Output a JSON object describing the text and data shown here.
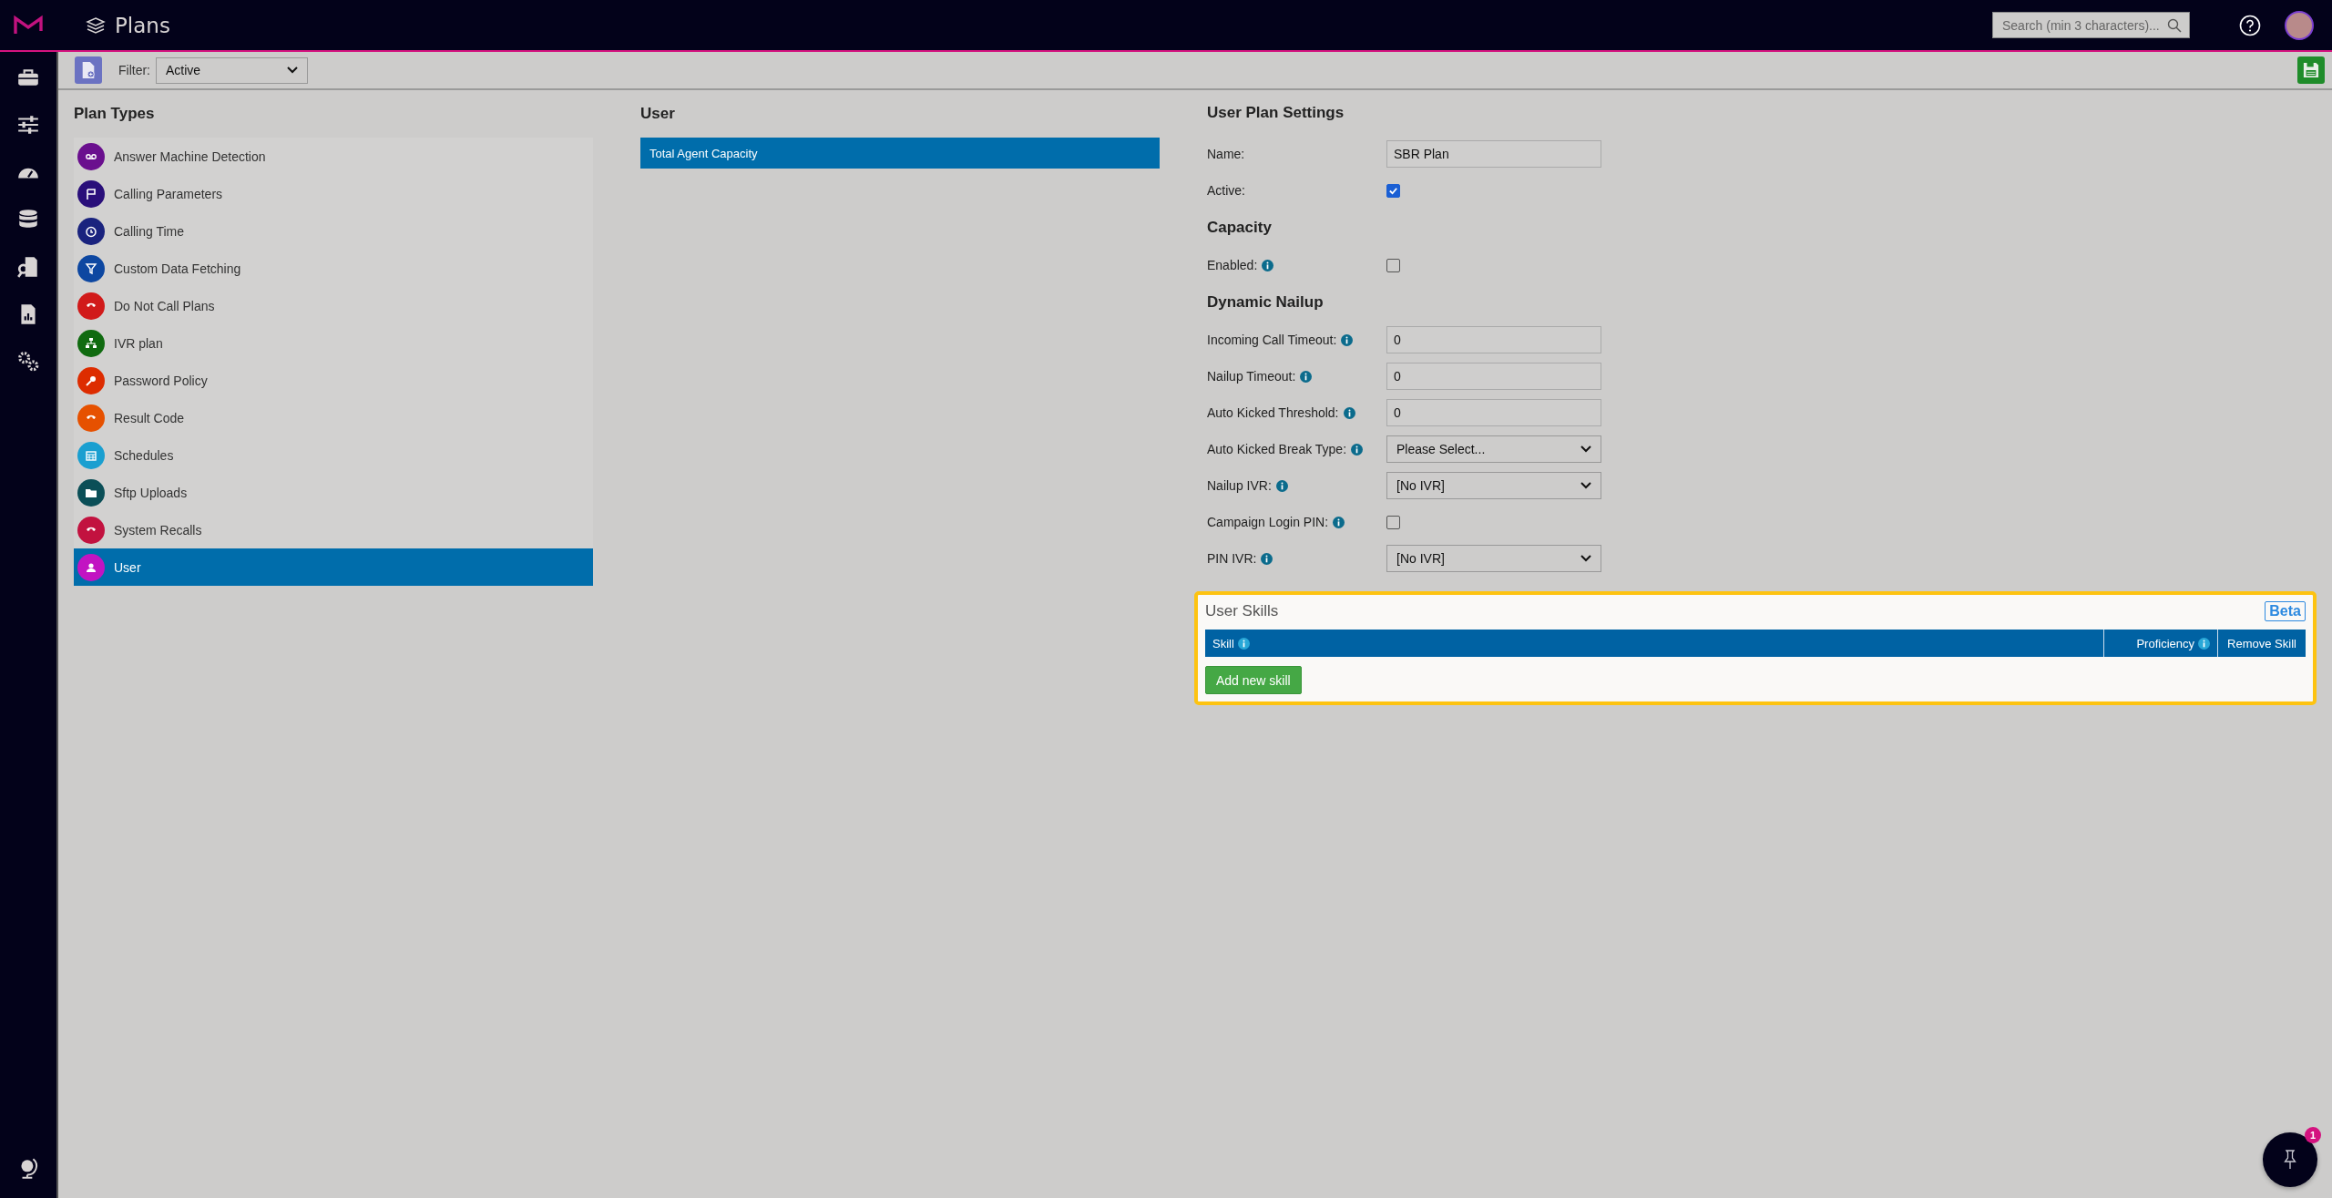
{
  "app": {
    "title": "Plans",
    "search": {
      "placeholder": "Search (min 3 characters)..."
    }
  },
  "nav": [
    {
      "kind": "toolbox"
    },
    {
      "kind": "sliders"
    },
    {
      "kind": "gauge"
    },
    {
      "kind": "database"
    },
    {
      "kind": "file-search"
    },
    {
      "kind": "report"
    },
    {
      "kind": "gears"
    }
  ],
  "nav_bottom": {
    "kind": "globe"
  },
  "toolbar": {
    "filter_label": "Filter:",
    "filter_value": "Active"
  },
  "plan_types": {
    "title": "Plan Types",
    "items": [
      {
        "label": "Answer Machine Detection",
        "color": "#6a0f8e",
        "selected": false
      },
      {
        "label": "Calling Parameters",
        "color": "#2a0f7a",
        "selected": false
      },
      {
        "label": "Calling Time",
        "color": "#1a237e",
        "selected": false
      },
      {
        "label": "Custom Data Fetching",
        "color": "#0d47a1",
        "selected": false
      },
      {
        "label": "Do Not Call Plans",
        "color": "#d11a1a",
        "selected": false
      },
      {
        "label": "IVR plan",
        "color": "#106b10",
        "selected": false
      },
      {
        "label": "Password Policy",
        "color": "#dd2c00",
        "selected": false
      },
      {
        "label": "Result Code",
        "color": "#e65100",
        "selected": false
      },
      {
        "label": "Schedules",
        "color": "#1a9fd0",
        "selected": false
      },
      {
        "label": "Sftp Uploads",
        "color": "#0b4f57",
        "selected": false
      },
      {
        "label": "System Recalls",
        "color": "#c2123f",
        "selected": false
      },
      {
        "label": "User",
        "color": "#c214c2",
        "selected": true
      }
    ]
  },
  "user_list": {
    "title": "User",
    "items": [
      {
        "label": "Total Agent Capacity",
        "selected": true
      }
    ]
  },
  "settings": [
    {
      "title": "User Plan Settings",
      "fields": [
        {
          "label": "Name:",
          "kind": "text",
          "value": "SBR Plan",
          "info": false
        },
        {
          "label": "Active:",
          "kind": "checkbox",
          "checked": true,
          "info": false
        }
      ]
    },
    {
      "title": "Capacity",
      "fields": [
        {
          "label": "Enabled:",
          "kind": "checkbox",
          "checked": false,
          "info": true
        }
      ]
    },
    {
      "title": "Dynamic Nailup",
      "fields": [
        {
          "label": "Incoming Call Timeout:",
          "kind": "text",
          "value": "0",
          "info": true
        },
        {
          "label": "Nailup Timeout:",
          "kind": "text",
          "value": "0",
          "info": true
        },
        {
          "label": "Auto Kicked Threshold:",
          "kind": "text",
          "value": "0",
          "info": true
        },
        {
          "label": "Auto Kicked Break Type:",
          "kind": "select",
          "value": "Please Select...",
          "info": true
        },
        {
          "label": "Nailup IVR:",
          "kind": "select",
          "value": "[No IVR]",
          "info": true
        },
        {
          "label": "Campaign Login PIN:",
          "kind": "checkbox",
          "checked": false,
          "info": true
        },
        {
          "label": "PIN IVR:",
          "kind": "select",
          "value": "[No IVR]",
          "info": true
        }
      ]
    }
  ],
  "skills": {
    "title": "User Skills",
    "badge": "Beta",
    "columns": [
      {
        "label": "Skill",
        "info": true
      },
      {
        "label": "Proficiency",
        "info": true
      },
      {
        "label": "Remove Skill",
        "info": false
      }
    ],
    "add_button": "Add new skill"
  },
  "pin_button": {
    "count": "1"
  }
}
